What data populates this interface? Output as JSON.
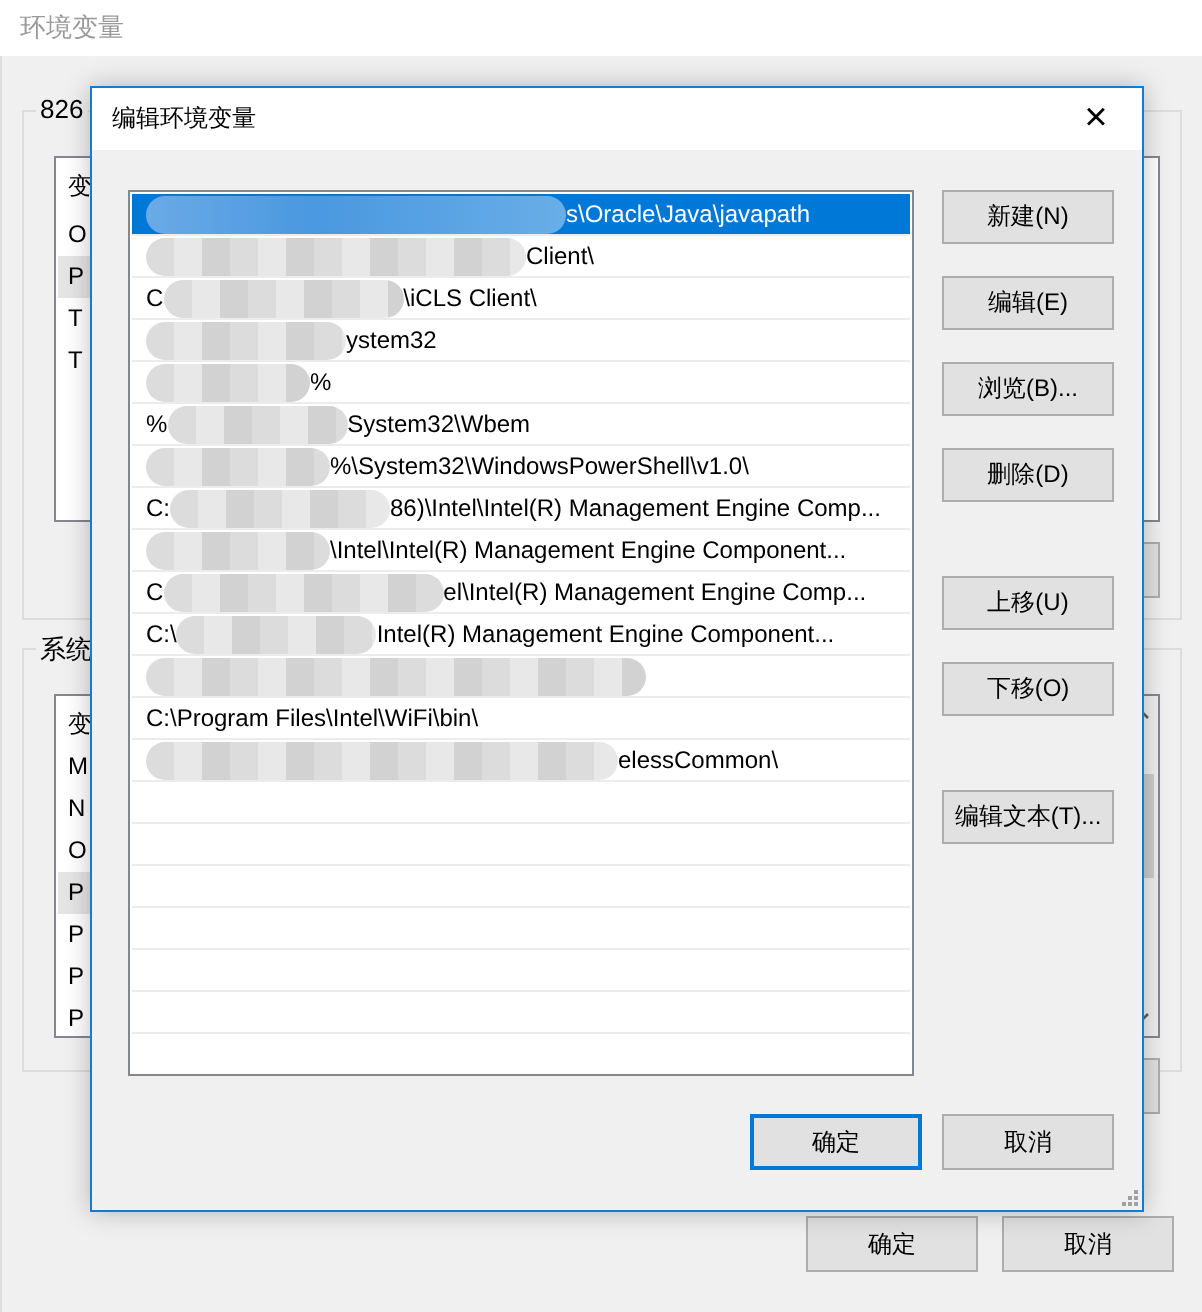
{
  "window": {
    "title": "环境变量",
    "user_group": {
      "label": "826",
      "header": "变",
      "rows": [
        {
          "text": "O",
          "selected": false
        },
        {
          "text": "P",
          "selected": true
        },
        {
          "text": "T",
          "selected": false
        },
        {
          "text": "T",
          "selected": false
        }
      ]
    },
    "system_group": {
      "label": "系统",
      "header": "变",
      "rows": [
        {
          "text": "M",
          "selected": false
        },
        {
          "text": "N",
          "selected": false
        },
        {
          "text": "O",
          "selected": false
        },
        {
          "text": "P",
          "selected": true
        },
        {
          "text": "P",
          "selected": false
        },
        {
          "text": "P",
          "selected": false
        },
        {
          "text": "P",
          "selected": false
        }
      ]
    },
    "buttons": [
      "确定",
      "取消"
    ]
  },
  "dialog": {
    "title": "编辑环境变量",
    "close": "×",
    "paths": [
      {
        "text": "s\\Oracle\\Java\\javapath",
        "redacted": true,
        "selected": true
      },
      {
        "text": "Client\\",
        "redacted": true,
        "selected": false
      },
      {
        "prefix": "C",
        "text": "\\iCLS Client\\",
        "redacted": true,
        "selected": false
      },
      {
        "text": "ystem32",
        "redacted": true,
        "selected": false
      },
      {
        "text": "%",
        "redacted": true,
        "selected": false
      },
      {
        "prefix": "%",
        "text": "System32\\Wbem",
        "redacted": true,
        "selected": false
      },
      {
        "text": "%\\System32\\WindowsPowerShell\\v1.0\\",
        "redacted": true,
        "selected": false
      },
      {
        "prefix": "C:",
        "text": "86)\\Intel\\Intel(R) Management Engine Comp...",
        "redacted": true,
        "selected": false
      },
      {
        "text": "\\Intel\\Intel(R) Management Engine Component...",
        "redacted": true,
        "selected": false
      },
      {
        "prefix": "C",
        "text": "el\\Intel(R) Management Engine Comp...",
        "redacted": true,
        "selected": false
      },
      {
        "prefix": "C:\\",
        "text": "Intel(R) Management Engine Component...",
        "redacted": true,
        "selected": false
      },
      {
        "redacted": true,
        "selected": false
      },
      {
        "text": "C:\\Program Files\\Intel\\WiFi\\bin\\",
        "redacted": false,
        "selected": false
      },
      {
        "text": "elessCommon\\",
        "redacted": true,
        "selected": false
      }
    ],
    "side_button_groups": [
      [
        "新建(N)",
        "编辑(E)",
        "浏览(B)...",
        "删除(D)"
      ],
      [
        "上移(U)",
        "下移(O)"
      ],
      [
        "编辑文本(T)..."
      ]
    ],
    "buttons": [
      {
        "label": "确定",
        "default": true
      },
      {
        "label": "取消",
        "default": false
      }
    ]
  }
}
